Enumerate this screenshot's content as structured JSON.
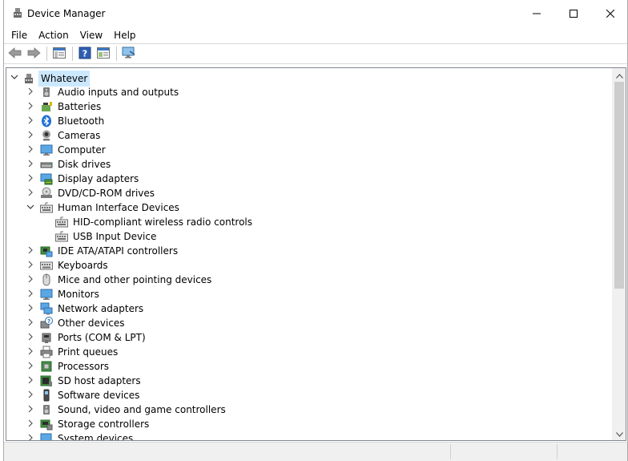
{
  "window": {
    "title": "Device Manager",
    "icon": "device-manager-icon"
  },
  "caption_buttons": {
    "minimize": "—",
    "maximize": "☐",
    "close": "✕"
  },
  "menu": [
    "File",
    "Action",
    "View",
    "Help"
  ],
  "toolbar": [
    "back-arrow-icon",
    "forward-arrow-icon",
    "show-hide-console-tree-icon",
    "help-icon",
    "properties-icon",
    "scan-hardware-icon"
  ],
  "tree": {
    "root": {
      "label": "Whatever",
      "expanded": true,
      "icon": "computer-icon"
    },
    "categories": [
      {
        "label": "Audio inputs and outputs",
        "icon": "speaker-icon",
        "expanded": false
      },
      {
        "label": "Batteries",
        "icon": "battery-icon",
        "expanded": false
      },
      {
        "label": "Bluetooth",
        "icon": "bluetooth-icon",
        "expanded": false
      },
      {
        "label": "Cameras",
        "icon": "camera-icon",
        "expanded": false
      },
      {
        "label": "Computer",
        "icon": "monitor-icon",
        "expanded": false
      },
      {
        "label": "Disk drives",
        "icon": "disk-drive-icon",
        "expanded": false
      },
      {
        "label": "Display adapters",
        "icon": "display-adapter-icon",
        "expanded": false
      },
      {
        "label": "DVD/CD-ROM drives",
        "icon": "optical-drive-icon",
        "expanded": false
      },
      {
        "label": "Human Interface Devices",
        "icon": "hid-icon",
        "expanded": true,
        "children": [
          {
            "label": "HID-compliant wireless radio controls",
            "icon": "hid-icon"
          },
          {
            "label": "USB Input Device",
            "icon": "hid-icon"
          }
        ]
      },
      {
        "label": "IDE ATA/ATAPI controllers",
        "icon": "ide-controller-icon",
        "expanded": false
      },
      {
        "label": "Keyboards",
        "icon": "keyboard-icon",
        "expanded": false
      },
      {
        "label": "Mice and other pointing devices",
        "icon": "mouse-icon",
        "expanded": false
      },
      {
        "label": "Monitors",
        "icon": "monitor-icon",
        "expanded": false
      },
      {
        "label": "Network adapters",
        "icon": "network-icon",
        "expanded": false
      },
      {
        "label": "Other devices",
        "icon": "unknown-device-icon",
        "expanded": false
      },
      {
        "label": "Ports (COM & LPT)",
        "icon": "port-icon",
        "expanded": false
      },
      {
        "label": "Print queues",
        "icon": "printer-icon",
        "expanded": false
      },
      {
        "label": "Processors",
        "icon": "processor-icon",
        "expanded": false
      },
      {
        "label": "SD host adapters",
        "icon": "sd-card-icon",
        "expanded": false
      },
      {
        "label": "Software devices",
        "icon": "software-device-icon",
        "expanded": false
      },
      {
        "label": "Sound, video and game controllers",
        "icon": "speaker-icon",
        "expanded": false
      },
      {
        "label": "Storage controllers",
        "icon": "storage-controller-icon",
        "expanded": false
      },
      {
        "label": "System devices",
        "icon": "system-device-icon",
        "expanded": false
      }
    ]
  },
  "scrollbar": {
    "position_fraction": 0.0,
    "visible_fraction": 0.6
  }
}
